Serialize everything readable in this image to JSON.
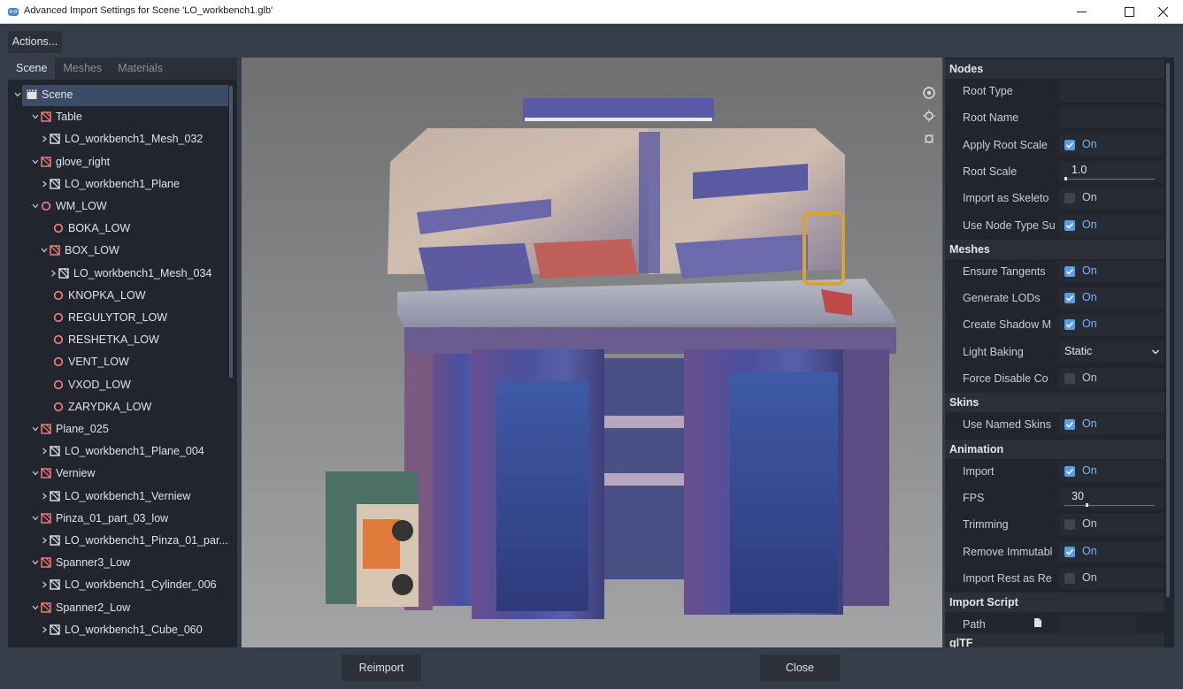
{
  "window": {
    "title": "Advanced Import Settings for Scene 'LO_workbench1.glb'"
  },
  "toolbar": {
    "actions_label": "Actions..."
  },
  "tabs": [
    {
      "label": "Scene",
      "active": true
    },
    {
      "label": "Meshes",
      "active": false
    },
    {
      "label": "Materials",
      "active": false
    }
  ],
  "tree": [
    {
      "label": "Scene",
      "depth": 0,
      "icon": "scene-icon",
      "expanded": true,
      "selected": true
    },
    {
      "label": "Table",
      "depth": 1,
      "icon": "node3d-icon",
      "expanded": true
    },
    {
      "label": "LO_workbench1_Mesh_032",
      "depth": 2,
      "icon": "mesh-instance-icon",
      "expanded": false
    },
    {
      "label": "glove_right",
      "depth": 1,
      "icon": "node3d-icon",
      "expanded": true
    },
    {
      "label": "LO_workbench1_Plane",
      "depth": 2,
      "icon": "mesh-instance-icon",
      "expanded": false
    },
    {
      "label": "WM_LOW",
      "depth": 1,
      "icon": "node-icon",
      "expanded": true
    },
    {
      "label": "BOKA_LOW",
      "depth": 2,
      "icon": "node-icon"
    },
    {
      "label": "BOX_LOW",
      "depth": 2,
      "icon": "node3d-icon",
      "expanded": true
    },
    {
      "label": "LO_workbench1_Mesh_034",
      "depth": 3,
      "icon": "mesh-instance-icon",
      "expanded": false
    },
    {
      "label": "KNOPKA_LOW",
      "depth": 2,
      "icon": "node-icon"
    },
    {
      "label": "REGULYTOR_LOW",
      "depth": 2,
      "icon": "node-icon"
    },
    {
      "label": "RESHETKA_LOW",
      "depth": 2,
      "icon": "node-icon"
    },
    {
      "label": "VENT_LOW",
      "depth": 2,
      "icon": "node-icon"
    },
    {
      "label": "VXOD_LOW",
      "depth": 2,
      "icon": "node-icon"
    },
    {
      "label": "ZARYDKA_LOW",
      "depth": 2,
      "icon": "node-icon"
    },
    {
      "label": "Plane_025",
      "depth": 1,
      "icon": "node3d-icon",
      "expanded": true
    },
    {
      "label": "LO_workbench1_Plane_004",
      "depth": 2,
      "icon": "mesh-instance-icon",
      "expanded": false
    },
    {
      "label": "Verniew",
      "depth": 1,
      "icon": "node3d-icon",
      "expanded": true
    },
    {
      "label": "LO_workbench1_Verniew",
      "depth": 2,
      "icon": "mesh-instance-icon",
      "expanded": false
    },
    {
      "label": "Pinza_01_part_03_low",
      "depth": 1,
      "icon": "node3d-icon",
      "expanded": true
    },
    {
      "label": "LO_workbench1_Pinza_01_par...",
      "depth": 2,
      "icon": "mesh-instance-icon",
      "expanded": false
    },
    {
      "label": "Spanner3_Low",
      "depth": 1,
      "icon": "node3d-icon",
      "expanded": true
    },
    {
      "label": "LO_workbench1_Cylinder_006",
      "depth": 2,
      "icon": "mesh-instance-icon",
      "expanded": false
    },
    {
      "label": "Spanner2_Low",
      "depth": 1,
      "icon": "node3d-icon",
      "expanded": true
    },
    {
      "label": "LO_workbench1_Cube_060",
      "depth": 2,
      "icon": "mesh-instance-icon",
      "expanded": false
    }
  ],
  "inspector": [
    {
      "kind": "section",
      "label": "Nodes"
    },
    {
      "kind": "text",
      "label": "Root Type",
      "value": ""
    },
    {
      "kind": "text",
      "label": "Root Name",
      "value": ""
    },
    {
      "kind": "check",
      "label": "Apply Root Scale",
      "checked": true,
      "value": "On"
    },
    {
      "kind": "slider",
      "label": "Root Scale",
      "value": "1.0",
      "level": 0.0
    },
    {
      "kind": "check",
      "label": "Import as Skeleto",
      "checked": false,
      "value": "On"
    },
    {
      "kind": "check",
      "label": "Use Node Type Su",
      "checked": true,
      "value": "On"
    },
    {
      "kind": "section",
      "label": "Meshes"
    },
    {
      "kind": "check",
      "label": "Ensure Tangents",
      "checked": true,
      "value": "On"
    },
    {
      "kind": "check",
      "label": "Generate LODs",
      "checked": true,
      "value": "On"
    },
    {
      "kind": "check",
      "label": "Create Shadow M",
      "checked": true,
      "value": "On"
    },
    {
      "kind": "select",
      "label": "Light Baking",
      "value": "Static"
    },
    {
      "kind": "check",
      "label": "Force Disable Co",
      "checked": false,
      "value": "On"
    },
    {
      "kind": "section",
      "label": "Skins"
    },
    {
      "kind": "check",
      "label": "Use Named Skins",
      "checked": true,
      "value": "On"
    },
    {
      "kind": "section",
      "label": "Animation"
    },
    {
      "kind": "check",
      "label": "Import",
      "checked": true,
      "value": "On"
    },
    {
      "kind": "slider",
      "label": "FPS",
      "value": "30",
      "level": 0.24
    },
    {
      "kind": "check",
      "label": "Trimming",
      "checked": false,
      "value": "On"
    },
    {
      "kind": "check",
      "label": "Remove Immutabl",
      "checked": true,
      "value": "On"
    },
    {
      "kind": "check",
      "label": "Import Rest as Re",
      "checked": false,
      "value": "On"
    },
    {
      "kind": "section",
      "label": "Import Script"
    },
    {
      "kind": "file",
      "label": "Path",
      "value": ""
    },
    {
      "kind": "section",
      "label": "glTF"
    }
  ],
  "buttons": {
    "reimport": "Reimport",
    "close": "Close"
  },
  "colors": {
    "accent": "#5a9ce6",
    "node_red": "#fc7f7f",
    "panel_bg": "#21262e",
    "window_bg": "#363d4a"
  }
}
